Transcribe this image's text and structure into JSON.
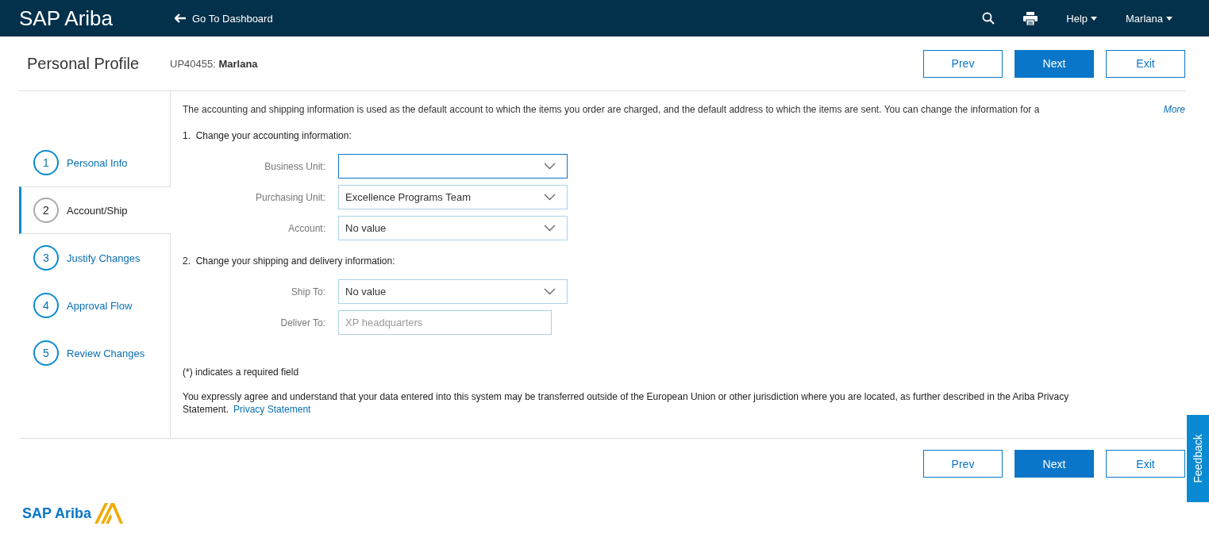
{
  "header": {
    "brand": "SAP Ariba",
    "back_link": "Go To Dashboard",
    "help": "Help",
    "user": "Marlana"
  },
  "page": {
    "title": "Personal Profile",
    "record_id": "UP40455:",
    "record_name": "Marlana"
  },
  "top_buttons": [
    {
      "label": "Prev",
      "kind": "secondary"
    },
    {
      "label": "Next",
      "kind": "primary"
    },
    {
      "label": "Exit",
      "kind": "secondary"
    }
  ],
  "steps": [
    {
      "number": "1",
      "label": "Personal Info",
      "selected": false
    },
    {
      "number": "2",
      "label": "Account/Ship",
      "selected": true
    },
    {
      "number": "3",
      "label": "Justify Changes",
      "selected": false
    },
    {
      "number": "4",
      "label": "Approval Flow",
      "selected": false
    },
    {
      "number": "5",
      "label": "Review Changes",
      "selected": false
    }
  ],
  "intro": "The accounting and shipping information is used as the default account to which the items you order are charged, and the default address to which the items are sent. You can change the information for a",
  "more_link": "More",
  "sections": [
    {
      "heading": "1.  Change your accounting information:",
      "fields": [
        {
          "label": "Business Unit:",
          "kind": "select",
          "focused": true
        },
        {
          "label": "Purchasing Unit:",
          "kind": "select",
          "value": "Excellence Programs Team",
          "focused": false
        },
        {
          "label": "Account:",
          "kind": "select",
          "value": "No value",
          "focused": false
        }
      ]
    },
    {
      "heading": "2.  Change your shipping and delivery information:",
      "fields": [
        {
          "label": "Ship To:",
          "kind": "select",
          "value": "No value",
          "focused": false
        },
        {
          "label": "Deliver To:",
          "kind": "text",
          "placeholder": "XP headquarters",
          "focused": false
        }
      ]
    }
  ],
  "required_note": "(*) indicates a required field",
  "privacy_text": "You expressly agree and understand that your data entered into this system may be transferred outside of the European Union or other jurisdiction where you are located, as further described in the Ariba Privacy Statement.",
  "privacy_link": "Privacy Statement",
  "bottom_buttons": [
    {
      "label": "Prev",
      "kind": "secondary"
    },
    {
      "label": "Next",
      "kind": "primary"
    },
    {
      "label": "Exit",
      "kind": "secondary"
    }
  ],
  "feedback": "Feedback",
  "footer_brand": "SAP Ariba"
}
